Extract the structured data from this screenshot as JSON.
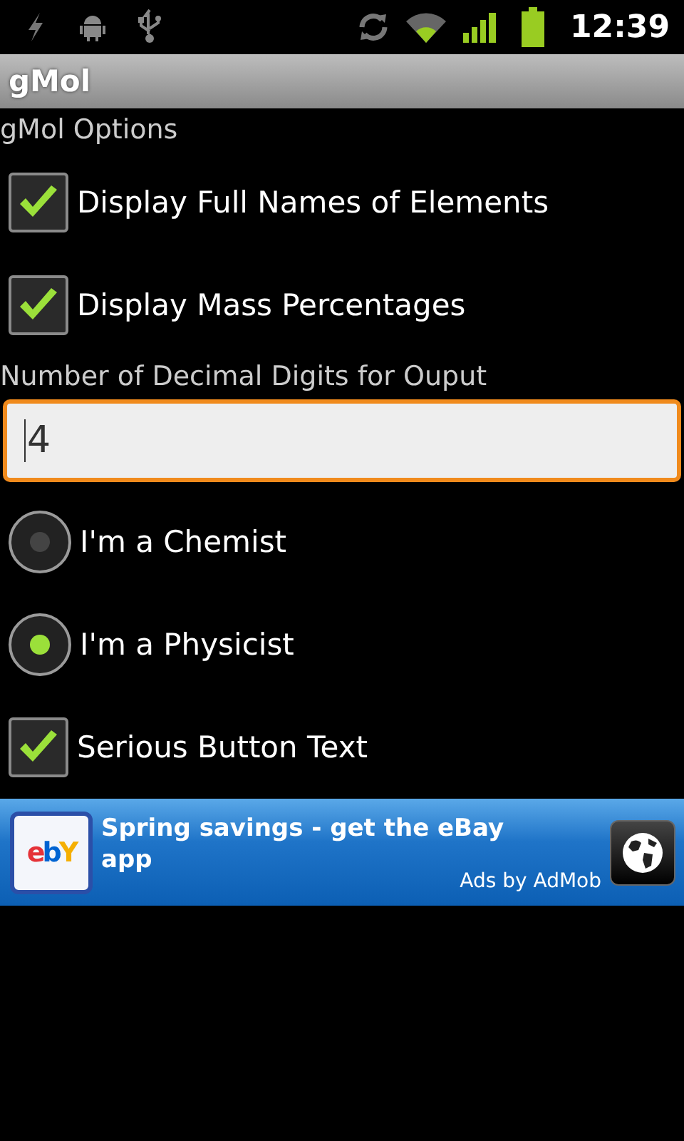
{
  "status_bar": {
    "time": "12:39"
  },
  "title_bar": {
    "title": "gMol"
  },
  "options": [
    {
      "kind": "header",
      "label": "gMol Options"
    },
    {
      "kind": "checkbox",
      "label": "Display Full Names of Elements",
      "checked": true
    },
    {
      "kind": "checkbox",
      "label": "Display Mass Percentages",
      "checked": true
    },
    {
      "kind": "field_label",
      "label": "Number of Decimal Digits for Ouput"
    },
    {
      "kind": "field",
      "value": "4",
      "focused": true
    },
    {
      "kind": "radio",
      "label": "I'm a Chemist",
      "selected": false
    },
    {
      "kind": "radio",
      "label": "I'm a Physicist",
      "selected": true
    },
    {
      "kind": "checkbox",
      "label": "Serious Button Text",
      "checked": true
    }
  ],
  "ad": {
    "logo": "ebY",
    "text": "Spring savings - get the eBay app",
    "attribution": "Ads by AdMob"
  }
}
